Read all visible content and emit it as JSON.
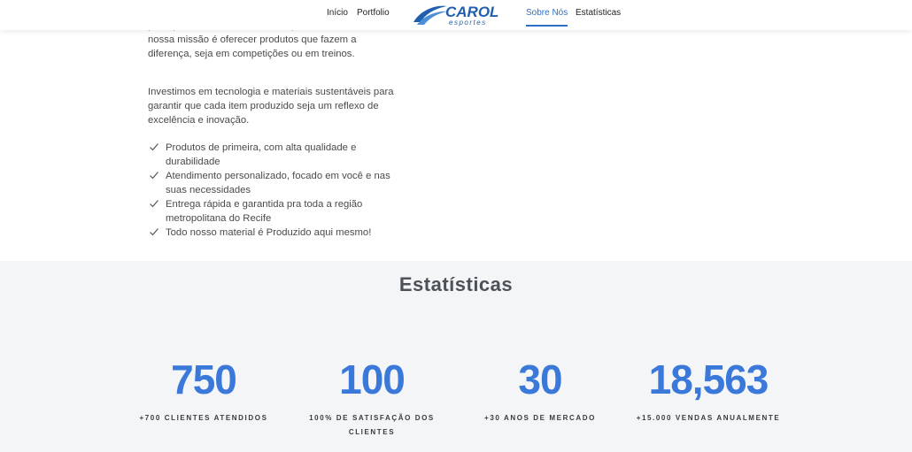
{
  "nav": {
    "links": [
      "Início",
      "Portfolio",
      "Sobre Nós",
      "Estatísticas"
    ],
    "logo_text": "CAROL",
    "logo_subtext": "esportes"
  },
  "about": {
    "paragraph1": "pela qualidade. Com anos de experiência no mercado, nossa missão é oferecer produtos que fazem a diferença, seja em competições ou em treinos.",
    "paragraph2": "Investimos em tecnologia e materiais sustentáveis para garantir que cada item produzido seja um reflexo de excelência e inovação.",
    "features": [
      "Produtos de primeira, com alta qualidade e durabilidade",
      "Atendimento personalizado, focado em você e nas suas necessidades",
      "Entrega rápida e garantida pra toda a região metropolitana do Recife",
      "Todo nosso material é Produzido aqui mesmo!"
    ]
  },
  "stats": {
    "title": "Estatísticas",
    "items": [
      {
        "number": "750",
        "label": "+700 clientes atendidos"
      },
      {
        "number": "100",
        "label": "100% de satisfação dos clientes"
      },
      {
        "number": "30",
        "label": "+30 anos de mercado"
      },
      {
        "number": "18,563",
        "label": "+15.000 vendas anualmente"
      }
    ]
  },
  "colors": {
    "accent": "#2c6fc7",
    "stat_number": "#3a78d9",
    "stats_bg": "#f4f5f6"
  }
}
